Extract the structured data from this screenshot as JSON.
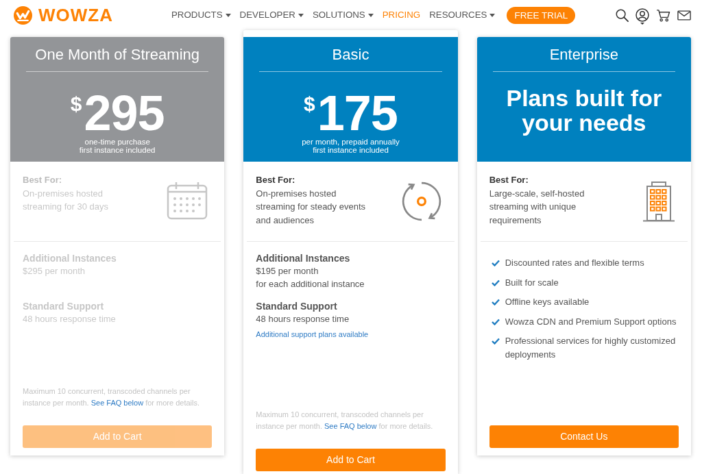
{
  "nav": {
    "brand": "WOWZA",
    "items": [
      {
        "label": "PRODUCTS",
        "dropdown": true,
        "selected": false
      },
      {
        "label": "DEVELOPER",
        "dropdown": true,
        "selected": false
      },
      {
        "label": "SOLUTIONS",
        "dropdown": true,
        "selected": false
      },
      {
        "label": "PRICING",
        "dropdown": false,
        "selected": true
      },
      {
        "label": "RESOURCES",
        "dropdown": true,
        "selected": false
      }
    ],
    "cta": "FREE TRIAL"
  },
  "plans": [
    {
      "kind": "priced",
      "title": "One Month of Streaming",
      "disabled": true,
      "featured": false,
      "currency": "$",
      "price": "295",
      "price_notes": [
        "one-time purchase",
        "first instance included"
      ],
      "best_for_label": "Best For:",
      "best_for": "On-premises hosted streaming for 30 days",
      "sections": [
        {
          "heading": "Additional Instances",
          "lines": [
            "$295 per month"
          ]
        },
        {
          "heading": "Standard Support",
          "lines": [
            "48 hours response time"
          ]
        }
      ],
      "footnote": {
        "text": "Maximum 10 concurrent, transcoded channels per instance per month.",
        "link": "See FAQ below",
        "text_after": "for more details."
      },
      "button": "Add to Cart"
    },
    {
      "kind": "priced",
      "title": "Basic",
      "disabled": false,
      "featured": true,
      "currency": "$",
      "price": "175",
      "price_notes": [
        "per month, prepaid annually",
        "first instance included"
      ],
      "best_for_label": "Best For:",
      "best_for": "On-premises hosted streaming for steady events and audiences",
      "sections": [
        {
          "heading": "Additional Instances",
          "lines": [
            "$195 per month",
            "for each additional instance"
          ]
        },
        {
          "heading": "Standard Support",
          "lines": [
            "48 hours response time"
          ],
          "link": "Additional support plans available"
        }
      ],
      "footnote": {
        "text": "Maximum 10 concurrent, transcoded channels per instance per month.",
        "link": "See FAQ below",
        "text_after": "for more details."
      },
      "button": "Add to Cart"
    },
    {
      "kind": "custom",
      "title": "Enterprise",
      "disabled": false,
      "featured": false,
      "headline": "Plans built for your needs",
      "best_for_label": "Best For:",
      "best_for": "Large-scale, self-hosted streaming with unique requirements",
      "features": [
        "Discounted rates and flexible terms",
        "Built for scale",
        "Offline keys available",
        "Wowza CDN and Premium Support options",
        "Professional services for highly customized deployments"
      ],
      "button": "Contact Us"
    }
  ]
}
